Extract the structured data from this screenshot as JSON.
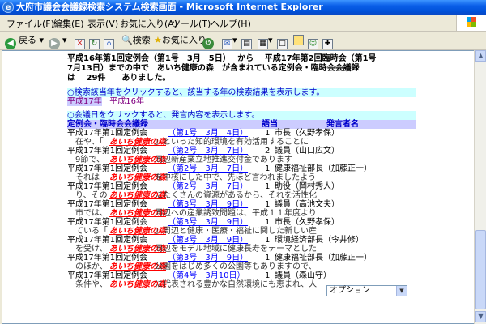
{
  "window": {
    "title": "大府市議会会議録検索システム検索画面 - Microsoft Internet Explorer"
  },
  "menu": [
    "ファイル(F)",
    "編集(E)",
    "表示(V)",
    "お気に入り(A)",
    "ツール(T)",
    "ヘルプ(H)"
  ],
  "toolbar": {
    "back_label": "戻る",
    "search_label": "検索",
    "favorites_label": "お気に入り"
  },
  "summary": {
    "line1": "平成16年第1回定例会（第1号　3月　5日）　 から　 平成17年第2回臨時会（第1号",
    "line2": "7月13日）までの中で　あいち健康の森　が含まれている定例会・臨時会会議録",
    "line3": "は　 29件　　ありました。"
  },
  "year_instruction": "○検索該当年をクリックすると、該当する年の検索結果を表示します。",
  "years": [
    "平成17年",
    "平成16年"
  ],
  "date_instruction": "○会議日をクリックすると、発言内容を表示します。",
  "table": {
    "headers": {
      "meeting": "定例会・臨時会会議録",
      "order": "語当",
      "speaker": "発言者名"
    },
    "rows": [
      {
        "meeting": "平成17年第1回定例会",
        "date": "（第1号　3月　4日）",
        "order": "1",
        "speaker": "市長（久野孝保）",
        "pre": "在や、「",
        "kw": "あいち健康の森",
        "post": "」といった知的環境を有効活用することに"
      },
      {
        "meeting": "平成17年第1回定例会",
        "date": "（第2号　3月　7日）",
        "order": "2",
        "speaker": "議員（山口広文）",
        "pre": "9節で、",
        "kw": "あいち健康の森",
        "post": "周辺新産業立地推進交付金であります"
      },
      {
        "meeting": "平成17年第1回定例会",
        "date": "（第2号　3月　7日）",
        "order": "1",
        "speaker": "健康福祉部長（加藤正一）",
        "pre": "それは",
        "kw": "あいち健康の森",
        "post": "を中核にした中で、先ほど言われましたよう"
      },
      {
        "meeting": "平成17年第1回定例会",
        "date": "（第2号　3月　7日）",
        "order": "1",
        "speaker": "助役（岡村秀人）",
        "pre": "り、その",
        "kw": "あいち健康の森",
        "post": "にたくさんの資源があるから、それを活性化"
      },
      {
        "meeting": "平成17年第1回定例会",
        "date": "（第3号　3月　9日）",
        "order": "1",
        "speaker": "議員（高池文夫）",
        "pre": "市では、",
        "kw": "あいち健康の森",
        "post": "周辺への産業誘致問題は、平成１１年度より"
      },
      {
        "meeting": "平成17年第1回定例会",
        "date": "（第3号　3月　9日）",
        "order": "1",
        "speaker": "市長（久野孝保）",
        "pre": "ている「",
        "kw": "あいち健康の森",
        "post": "」周辺と健康・医療・福祉に関した新しい産"
      },
      {
        "meeting": "平成17年第1回定例会",
        "date": "（第3号　3月　9日）",
        "order": "1",
        "speaker": "環境経済部長（今井修）",
        "pre": "を受け、",
        "kw": "あいち健康の森",
        "post": "周辺をモデル地域に健康長寿をテーマとした"
      },
      {
        "meeting": "平成17年第1回定例会",
        "date": "（第3号　3月　9日）",
        "order": "1",
        "speaker": "健康福祉部長（加藤正一）",
        "pre": "のほか、",
        "kw": "あいち健康の森",
        "post": "公園をはじめ多くの公園等もありますので、"
      },
      {
        "meeting": "平成17年第1回定例会",
        "date": "（第4号　3月10日）",
        "order": "1",
        "speaker": "議員（森山守）",
        "pre": "条件や、",
        "kw": "あいち健康の森",
        "post": "に代表される豊かな自然環境にも恵まれ、人"
      }
    ]
  },
  "option_select": "オプション"
}
